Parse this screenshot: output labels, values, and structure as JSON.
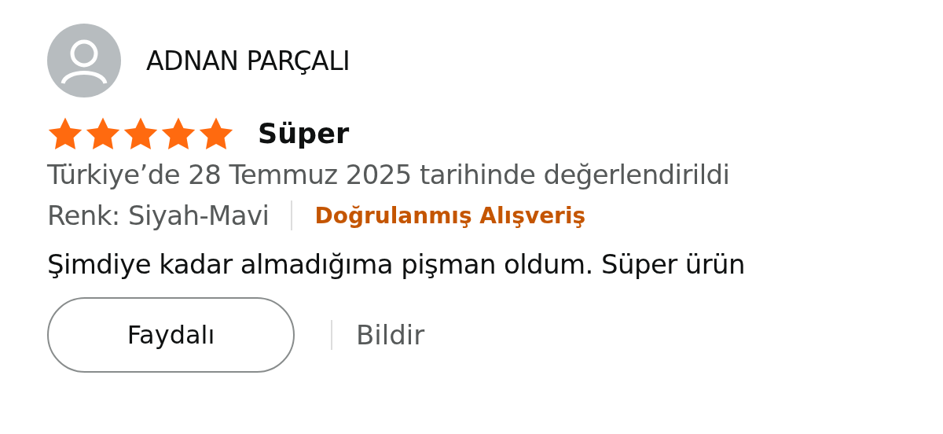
{
  "review": {
    "author": "ADNAN PARÇALI",
    "stars": 5,
    "title": "Süper",
    "date": "Türkiye’de 28 Temmuz 2025 tarihinde değerlendirildi",
    "variant": "Renk: Siyah-Mavi",
    "verified": "Doğrulanmış Alışveriş",
    "body": "Şimdiye kadar almadığıma pişman oldum. Süper ürün"
  },
  "actions": {
    "helpful": "Faydalı",
    "report": "Bildir"
  }
}
